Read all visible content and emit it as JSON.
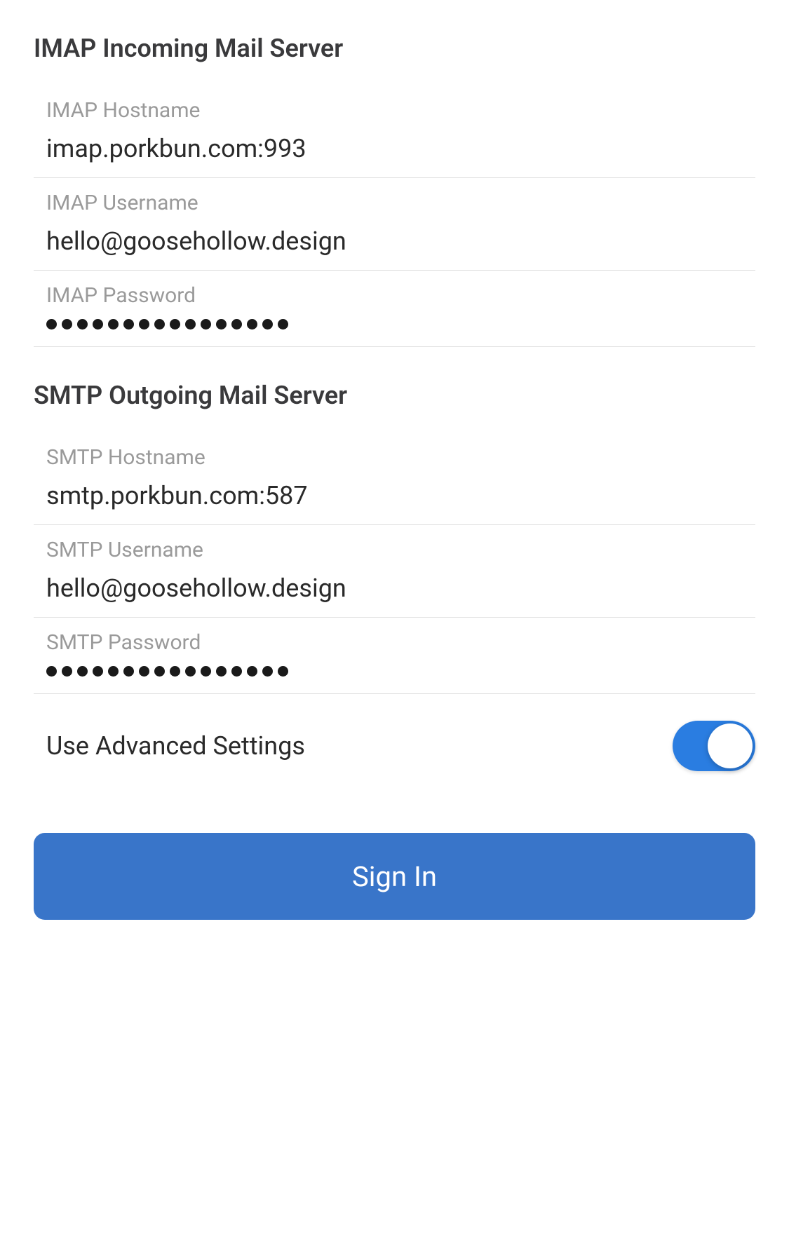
{
  "imap": {
    "heading": "IMAP Incoming Mail Server",
    "hostname_label": "IMAP Hostname",
    "hostname_value": "imap.porkbun.com:993",
    "username_label": "IMAP Username",
    "username_value": "hello@goosehollow.design",
    "password_label": "IMAP Password",
    "password_dot_count": 16
  },
  "smtp": {
    "heading": "SMTP Outgoing Mail Server",
    "hostname_label": "SMTP Hostname",
    "hostname_value": "smtp.porkbun.com:587",
    "username_label": "SMTP Username",
    "username_value": "hello@goosehollow.design",
    "password_label": "SMTP Password",
    "password_dot_count": 16
  },
  "advanced": {
    "label": "Use Advanced Settings",
    "enabled": true
  },
  "actions": {
    "sign_in": "Sign In"
  }
}
